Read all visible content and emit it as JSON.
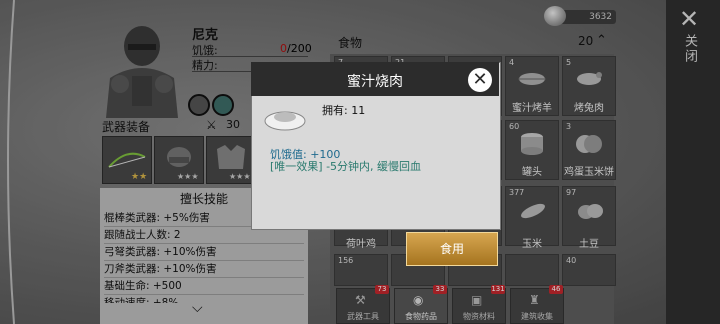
{
  "header": {
    "close_label": "关闭",
    "currency_value": "3632"
  },
  "character": {
    "name": "尼克",
    "hunger_label": "饥饿:",
    "hunger_current": "0",
    "hunger_max": "/200",
    "stamina_label": "精力:"
  },
  "weapons": {
    "section_title": "武器装备",
    "count": "30"
  },
  "skills": {
    "title": "擅长技能",
    "rows": [
      "棍棒类武器: +5%伤害",
      "跟随战士人数: 2",
      "弓弩类武器: +10%伤害",
      "刀斧类武器: +10%伤害",
      "基础生命: +500",
      "移动速度: +8%"
    ]
  },
  "inventory": {
    "title": "食物",
    "count": "20",
    "cells": [
      {
        "num": "7",
        "label": ""
      },
      {
        "num": "21",
        "label": ""
      },
      {
        "num": "",
        "label": ""
      },
      {
        "num": "4",
        "label": "蜜汁烤羊"
      },
      {
        "num": "5",
        "label": "烤兔肉"
      },
      {
        "num": "",
        "label": ""
      },
      {
        "num": "",
        "label": ""
      },
      {
        "num": "",
        "label": ""
      },
      {
        "num": "60",
        "label": "罐头"
      },
      {
        "num": "3",
        "label": "鸡蛋玉米饼"
      },
      {
        "num": "",
        "label": "荷叶鸡"
      },
      {
        "num": "",
        "label": ""
      },
      {
        "num": "",
        "label": ""
      },
      {
        "num": "377",
        "label": "玉米"
      },
      {
        "num": "97",
        "label": "土豆"
      },
      {
        "num": "156",
        "label": ""
      },
      {
        "num": "",
        "label": ""
      },
      {
        "num": "",
        "label": ""
      },
      {
        "num": "",
        "label": ""
      },
      {
        "num": "40",
        "label": ""
      }
    ],
    "tabs": [
      {
        "label": "武器工具",
        "badge": "73"
      },
      {
        "label": "食物药品",
        "badge": "33"
      },
      {
        "label": "物资材料",
        "badge": "131"
      },
      {
        "label": "建筑收集",
        "badge": "46"
      }
    ]
  },
  "modal": {
    "title": "蜜汁烧肉",
    "owned": "拥有: 11",
    "satiety": "饥饿值: +100",
    "effect": "[唯一效果] -5分钟内, 缓慢回血",
    "use_label": "食用"
  },
  "colors": {
    "accent_gold": "#c89438",
    "header_dark": "#2c2c2c",
    "badge_red": "#c4282e",
    "hunger_red": "#b01010"
  }
}
